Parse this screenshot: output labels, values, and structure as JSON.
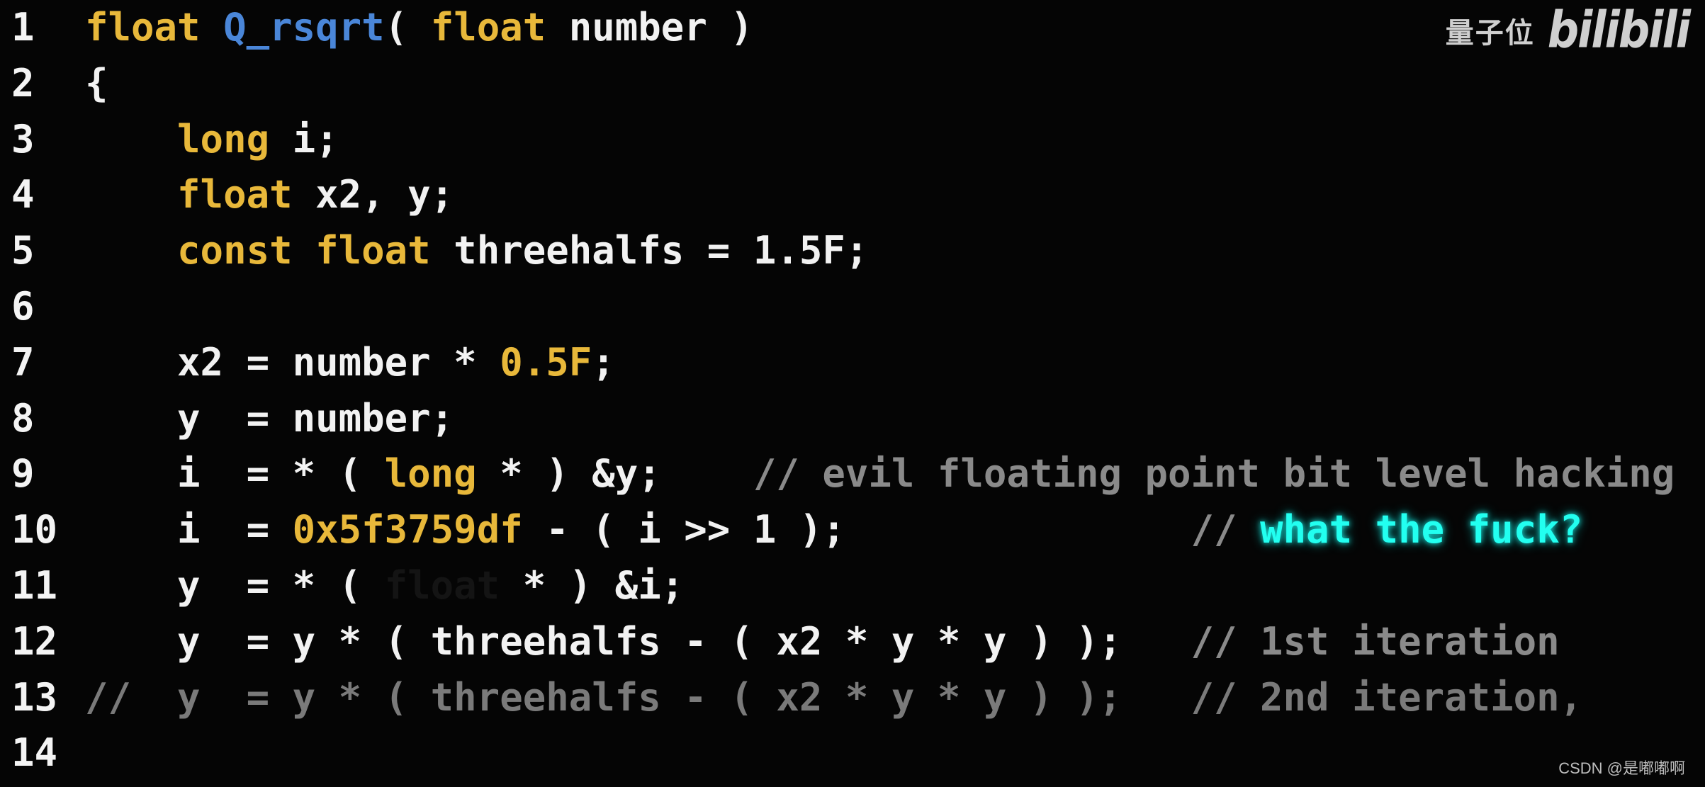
{
  "colors": {
    "background": "#050505",
    "keyword": "#e8b83a",
    "function": "#4a86d8",
    "plain": "#f2f2f2",
    "comment": "#8a8a8a",
    "highlight": "#22fff0"
  },
  "watermark": {
    "channel": "量子位",
    "logo": "bilibili"
  },
  "credit": "CSDN @是嘟嘟啊",
  "lines": [
    {
      "n": "1",
      "tokens": [
        {
          "t": "float",
          "k": "kw"
        },
        {
          "t": " ",
          "k": "plain"
        },
        {
          "t": "Q_rsqrt",
          "k": "fn"
        },
        {
          "t": "( ",
          "k": "plain"
        },
        {
          "t": "float",
          "k": "kw"
        },
        {
          "t": " number )",
          "k": "plain"
        }
      ]
    },
    {
      "n": "2",
      "tokens": [
        {
          "t": "{",
          "k": "plain"
        }
      ]
    },
    {
      "n": "3",
      "tokens": [
        {
          "t": "    ",
          "k": "plain"
        },
        {
          "t": "long",
          "k": "kw"
        },
        {
          "t": " i;",
          "k": "plain"
        }
      ]
    },
    {
      "n": "4",
      "tokens": [
        {
          "t": "    ",
          "k": "plain"
        },
        {
          "t": "float",
          "k": "kw"
        },
        {
          "t": " x2, y;",
          "k": "plain"
        }
      ]
    },
    {
      "n": "5",
      "tokens": [
        {
          "t": "    ",
          "k": "plain"
        },
        {
          "t": "const float",
          "k": "kw"
        },
        {
          "t": " threehalfs = 1.5F;",
          "k": "plain"
        }
      ]
    },
    {
      "n": "6",
      "tokens": []
    },
    {
      "n": "7",
      "tokens": [
        {
          "t": "    x2 = number * ",
          "k": "plain"
        },
        {
          "t": "0.5F",
          "k": "num"
        },
        {
          "t": ";",
          "k": "plain"
        }
      ]
    },
    {
      "n": "8",
      "tokens": [
        {
          "t": "    y  = number;",
          "k": "plain"
        }
      ]
    },
    {
      "n": "9",
      "tokens": [
        {
          "t": "    i  = * ( ",
          "k": "plain"
        },
        {
          "t": "long",
          "k": "kw"
        },
        {
          "t": " * ) &y;    ",
          "k": "plain"
        },
        {
          "t": "// evil floating point bit level hacking",
          "k": "comment"
        }
      ]
    },
    {
      "n": "10",
      "tokens": [
        {
          "t": "    i  = ",
          "k": "plain"
        },
        {
          "t": "0x5f3759df",
          "k": "num"
        },
        {
          "t": " - ( i >> 1 );               ",
          "k": "plain"
        },
        {
          "t": "// ",
          "k": "comment"
        },
        {
          "t": "what the fuck?",
          "k": "glow"
        }
      ]
    },
    {
      "n": "11",
      "tokens": [
        {
          "t": "    y  = * ( ",
          "k": "plain"
        },
        {
          "t": "float",
          "k": "hidden"
        },
        {
          "t": " * ) &i;",
          "k": "plain"
        }
      ]
    },
    {
      "n": "12",
      "tokens": [
        {
          "t": "    y  = y * ( threehalfs - ( x2 * y * y ) );   ",
          "k": "plain"
        },
        {
          "t": "// 1st iteration",
          "k": "comment"
        }
      ]
    },
    {
      "n": "13",
      "tokens": [
        {
          "t": "//  y  = y * ( threehalfs - ( x2 * y * y ) );   // 2nd iteration,",
          "k": "faded"
        }
      ]
    },
    {
      "n": "14",
      "tokens": []
    }
  ]
}
